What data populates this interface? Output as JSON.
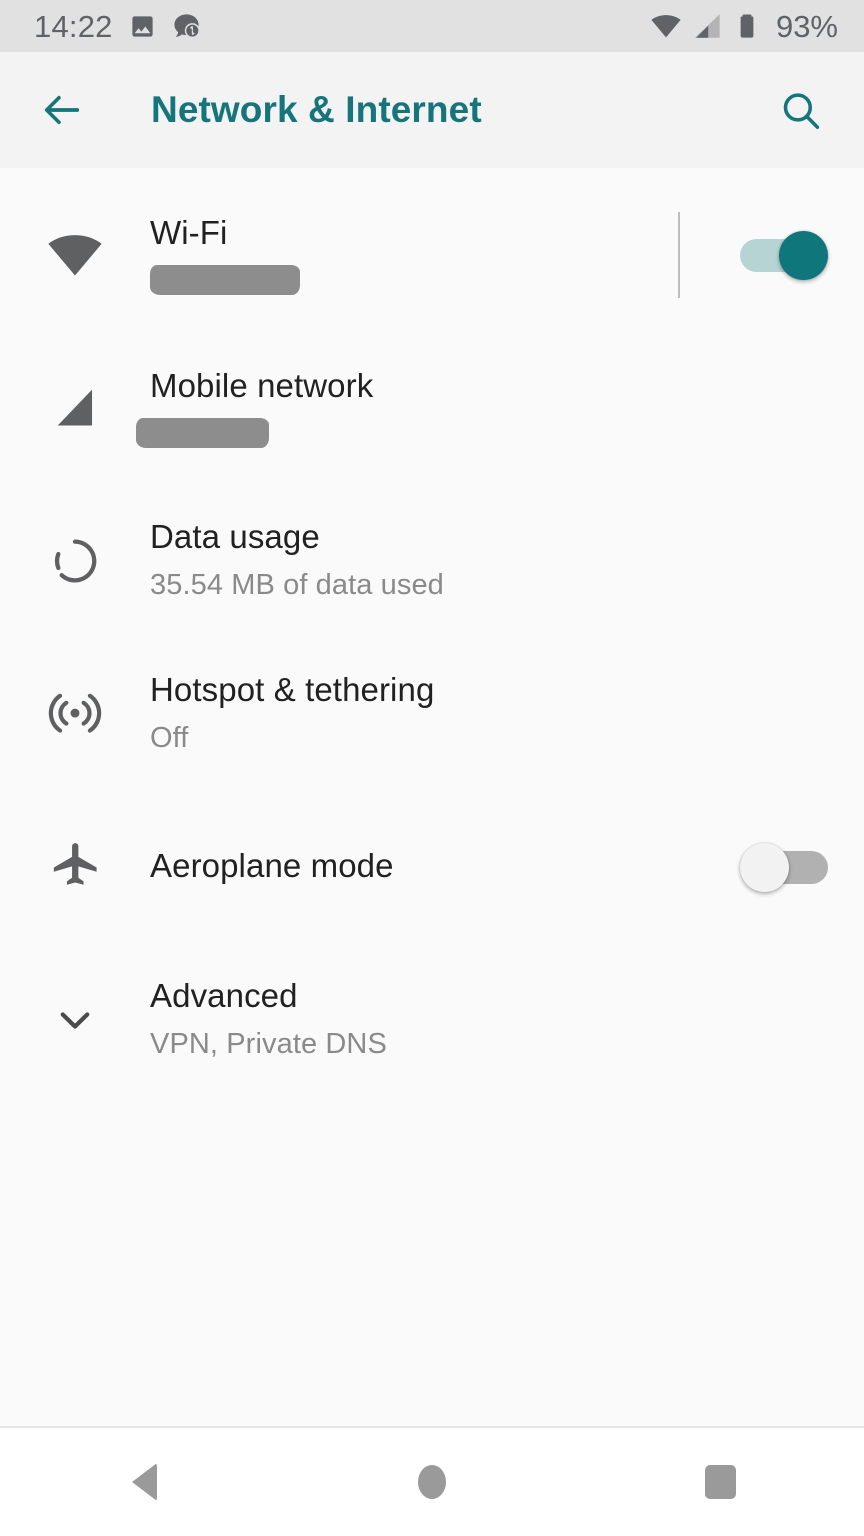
{
  "status_bar": {
    "clock": "14:22",
    "battery_percent": "93%",
    "left_icons": [
      "image-icon",
      "message-sync-icon"
    ],
    "right_icons": [
      "wifi-signal-icon",
      "cellular-signal-icon",
      "battery-icon"
    ],
    "background_color": "#e1e1e1",
    "text_color": "#5f6368"
  },
  "app_bar": {
    "title": "Network & Internet",
    "back_icon": "arrow-left-icon",
    "search_icon": "search-icon",
    "accent_color": "#15757a",
    "background_color": "#f3f3f3"
  },
  "settings": {
    "rows": [
      {
        "id": "wifi",
        "icon": "wifi-icon",
        "title": "Wi-Fi",
        "subtitle": "",
        "redacted_subtitle": true,
        "has_divider": true,
        "toggle": "on"
      },
      {
        "id": "mobile-network",
        "icon": "cellular-signal-icon",
        "title": "Mobile network",
        "subtitle": "",
        "redacted_subtitle": true,
        "has_divider": false,
        "toggle": null
      },
      {
        "id": "data-usage",
        "icon": "data-usage-icon",
        "title": "Data usage",
        "subtitle": "35.54 MB of data used",
        "redacted_subtitle": false,
        "has_divider": false,
        "toggle": null
      },
      {
        "id": "hotspot-tethering",
        "icon": "hotspot-icon",
        "title": "Hotspot & tethering",
        "subtitle": "Off",
        "redacted_subtitle": false,
        "has_divider": false,
        "toggle": null
      },
      {
        "id": "aeroplane-mode",
        "icon": "airplane-icon",
        "title": "Aeroplane mode",
        "subtitle": "",
        "redacted_subtitle": false,
        "has_divider": false,
        "toggle": "off"
      },
      {
        "id": "advanced",
        "icon": "chevron-down-icon",
        "title": "Advanced",
        "subtitle": "VPN, Private DNS",
        "redacted_subtitle": false,
        "has_divider": false,
        "toggle": null
      }
    ],
    "toggle_on_color": "#0f767c",
    "toggle_on_track_color": "#b6d4d4",
    "toggle_off_color": "#f2f2f2",
    "toggle_off_track_color": "#b1b1b1",
    "background_color": "#fafafa",
    "title_color": "#212121",
    "subtitle_color": "#8a8a8a"
  },
  "nav_bar": {
    "buttons": [
      {
        "id": "back",
        "icon": "nav-back-triangle-icon"
      },
      {
        "id": "home",
        "icon": "nav-home-circle-icon"
      },
      {
        "id": "recents",
        "icon": "nav-recents-square-icon"
      }
    ],
    "icon_color": "#9a9a9a",
    "background_color": "#ffffff"
  }
}
